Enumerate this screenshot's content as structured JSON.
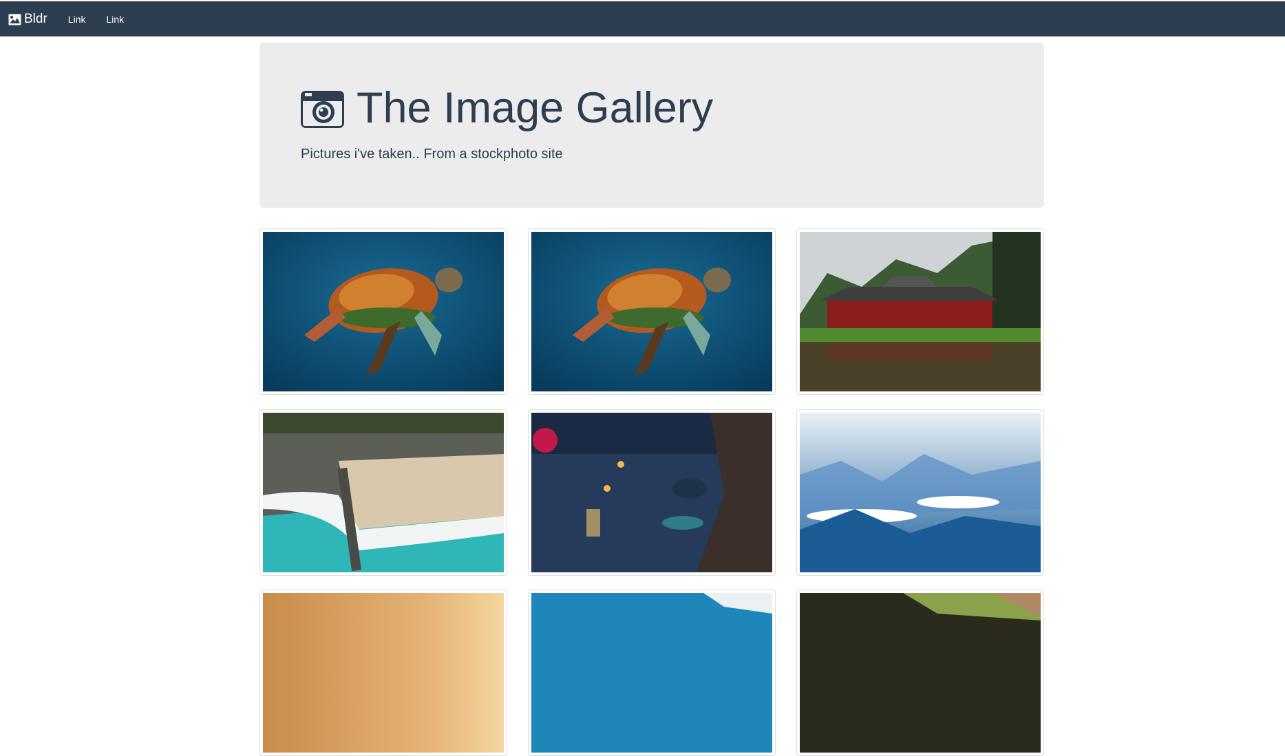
{
  "navbar": {
    "brand_label": "Bldr",
    "brand_icon": "image-icon",
    "links": [
      "Link",
      "Link"
    ]
  },
  "jumbotron": {
    "title": "The Image Gallery",
    "title_icon": "camera-icon",
    "subtitle": "Pictures i've taken.. From a stockphoto site"
  },
  "gallery": {
    "images": [
      {
        "subject": "sea-turtle"
      },
      {
        "subject": "sea-turtle"
      },
      {
        "subject": "red-temple-by-pond"
      },
      {
        "subject": "aerial-beach"
      },
      {
        "subject": "dinner-table-night"
      },
      {
        "subject": "mountains-above-clouds"
      },
      {
        "subject": "sunset-sky"
      },
      {
        "subject": "ocean-aerial"
      },
      {
        "subject": "dark-foliage"
      }
    ]
  },
  "colors": {
    "navbar_bg": "#2c3e50",
    "jumbotron_bg": "#ececec",
    "text_primary": "#2c3e50"
  }
}
